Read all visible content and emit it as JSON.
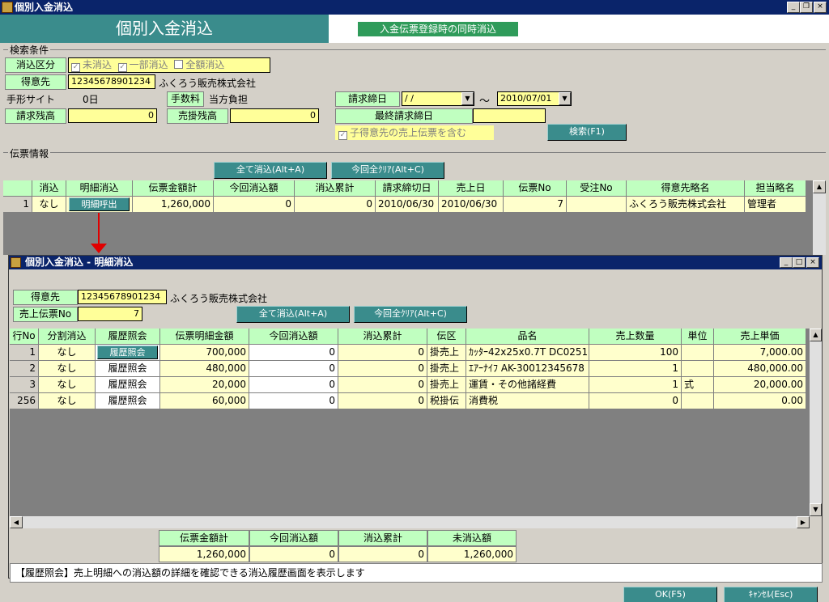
{
  "window": {
    "title": "個別入金消込"
  },
  "header": {
    "title": "個別入金消込",
    "simul_label": "入金伝票登録時の同時消込"
  },
  "search": {
    "section": "検索条件",
    "status_label": "消込区分",
    "status_opts": [
      "未消込",
      "一部消込",
      "全額消込"
    ],
    "customer_label": "得意先",
    "customer_code": "12345678901234",
    "customer_name": "ふくろう販売株式会社",
    "bill_site_label": "手形サイト",
    "bill_site_value": "0日",
    "fee_label": "手数料",
    "fee_value": "当方負担",
    "close_label": "請求締日",
    "close_from": " /  /",
    "close_sep": "～",
    "close_to": "2010/07/01",
    "bill_bal_label": "請求残高",
    "bill_bal_value": "0",
    "ar_bal_label": "売掛残高",
    "ar_bal_value": "0",
    "last_close_label": "最終請求締日",
    "last_close_value": "",
    "include_child": "子得意先の売上伝票を含む",
    "search_btn": "検索(F1)"
  },
  "slip": {
    "section": "伝票情報",
    "clear_all_btn": "全て消込(Alt+A)",
    "clear_this_btn": "今回全ｸﾘｱ(Alt+C)",
    "columns": [
      "消込",
      "明細消込",
      "伝票金額計",
      "今回消込額",
      "消込累計",
      "請求締切日",
      "売上日",
      "伝票No",
      "受注No",
      "得意先略名",
      "担当略名"
    ],
    "row": {
      "no": "1",
      "status": "なし",
      "detail_btn": "明細呼出",
      "amount": "1,260,000",
      "current": "0",
      "cumulative": "0",
      "close_date": "2010/06/30",
      "sales_date": "2010/06/30",
      "slip_no": "7",
      "order_no": "",
      "customer": "ふくろう販売株式会社",
      "staff": "管理者"
    }
  },
  "dialog": {
    "title": "個別入金消込 - 明細消込",
    "customer_label": "得意先",
    "customer_code": "12345678901234",
    "customer_name": "ふくろう販売株式会社",
    "slip_label": "売上伝票No",
    "slip_no": "7",
    "clear_all_btn": "全て消込(Alt+A)",
    "clear_this_btn": "今回全ｸﾘｱ(Alt+C)",
    "columns": [
      "行No",
      "分割消込",
      "履歴照会",
      "伝票明細金額",
      "今回消込額",
      "消込累計",
      "伝区",
      "品名",
      "売上数量",
      "単位",
      "売上単価"
    ],
    "rows": [
      {
        "no": "1",
        "split": "なし",
        "hist": "履歴照会",
        "amount": "700,000",
        "current": "0",
        "cumulative": "0",
        "kind": "掛売上",
        "item": "ｶｯﾀｰ42x25x0.7T DC0251",
        "qty": "100",
        "unit": "",
        "price": "7,000.00"
      },
      {
        "no": "2",
        "split": "なし",
        "hist": "履歴照会",
        "amount": "480,000",
        "current": "0",
        "cumulative": "0",
        "kind": "掛売上",
        "item": "ｴｱｰﾅｲﾌ AK-30012345678",
        "qty": "1",
        "unit": "",
        "price": "480,000.00"
      },
      {
        "no": "3",
        "split": "なし",
        "hist": "履歴照会",
        "amount": "20,000",
        "current": "0",
        "cumulative": "0",
        "kind": "掛売上",
        "item": "運賃・その他諸経費",
        "qty": "1",
        "unit": "式",
        "price": "20,000.00"
      },
      {
        "no": "256",
        "split": "なし",
        "hist": "履歴照会",
        "amount": "60,000",
        "current": "0",
        "cumulative": "0",
        "kind": "税掛伝",
        "item": "消費税",
        "qty": "0",
        "unit": "",
        "price": "0.00"
      }
    ],
    "totals": {
      "labels": [
        "伝票金額計",
        "今回消込額",
        "消込累計",
        "未消込額"
      ],
      "values": [
        "1,260,000",
        "0",
        "0",
        "1,260,000"
      ]
    }
  },
  "help_text": "【履歴照会】売上明細への消込額の詳細を確認できる消込履歴画面を表示します",
  "footer": {
    "ok_btn": "OK(F5)",
    "cancel_btn": "ｷｬﾝｾﾙ(Esc)"
  },
  "colors": {
    "titlebar": "#0a246a",
    "header": "#3a8c8c",
    "label_green": "#c0ffc0",
    "input_yellow": "#ffff99",
    "row_yellow": "#ffffcc",
    "arrow_red": "#e00000"
  }
}
